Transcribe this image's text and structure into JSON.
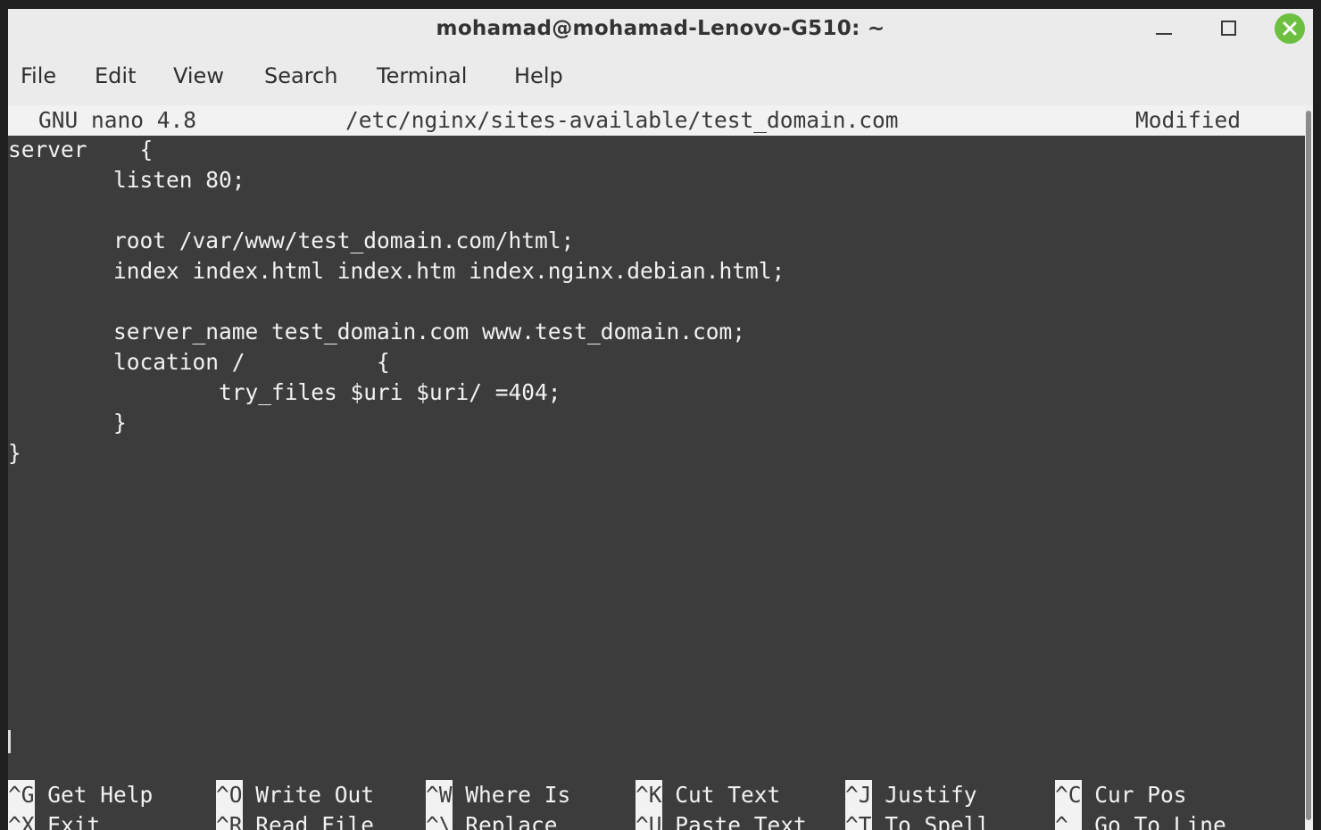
{
  "window": {
    "title": "mohamad@mohamad-Lenovo-G510: ~",
    "controls": [
      "minimize-icon",
      "maximize-icon",
      "close-icon"
    ]
  },
  "menubar": {
    "items": [
      "File",
      "Edit",
      "View",
      "Search",
      "Terminal",
      "Help"
    ]
  },
  "nano": {
    "version": "GNU nano 4.8",
    "file": "/etc/nginx/sites-available/test_domain.com",
    "status": "Modified",
    "lines": [
      "server    {",
      "        listen 80;",
      "",
      "        root /var/www/test_domain.com/html;",
      "        index index.html index.htm index.nginx.debian.html;",
      "",
      "        server_name test_domain.com www.test_domain.com;",
      "        location /          {",
      "                try_files $uri $uri/ =404;",
      "        }",
      "}"
    ],
    "shortcuts_row1": [
      {
        "key": "^G",
        "label": "Get Help"
      },
      {
        "key": "^O",
        "label": "Write Out"
      },
      {
        "key": "^W",
        "label": "Where Is"
      },
      {
        "key": "^K",
        "label": "Cut Text"
      },
      {
        "key": "^J",
        "label": "Justify"
      },
      {
        "key": "^C",
        "label": "Cur Pos"
      }
    ],
    "shortcuts_row2": [
      {
        "key": "^X",
        "label": "Exit"
      },
      {
        "key": "^R",
        "label": "Read File"
      },
      {
        "key": "^\\",
        "label": "Replace"
      },
      {
        "key": "^U",
        "label": "Paste Text"
      },
      {
        "key": "^T",
        "label": "To Spell"
      },
      {
        "key": "^_",
        "label": "Go To Line"
      }
    ]
  },
  "colors": {
    "terminal_bg": "#3c3c3c",
    "terminal_fg": "#f2f2f2",
    "close_button": "#6cbf3f"
  }
}
